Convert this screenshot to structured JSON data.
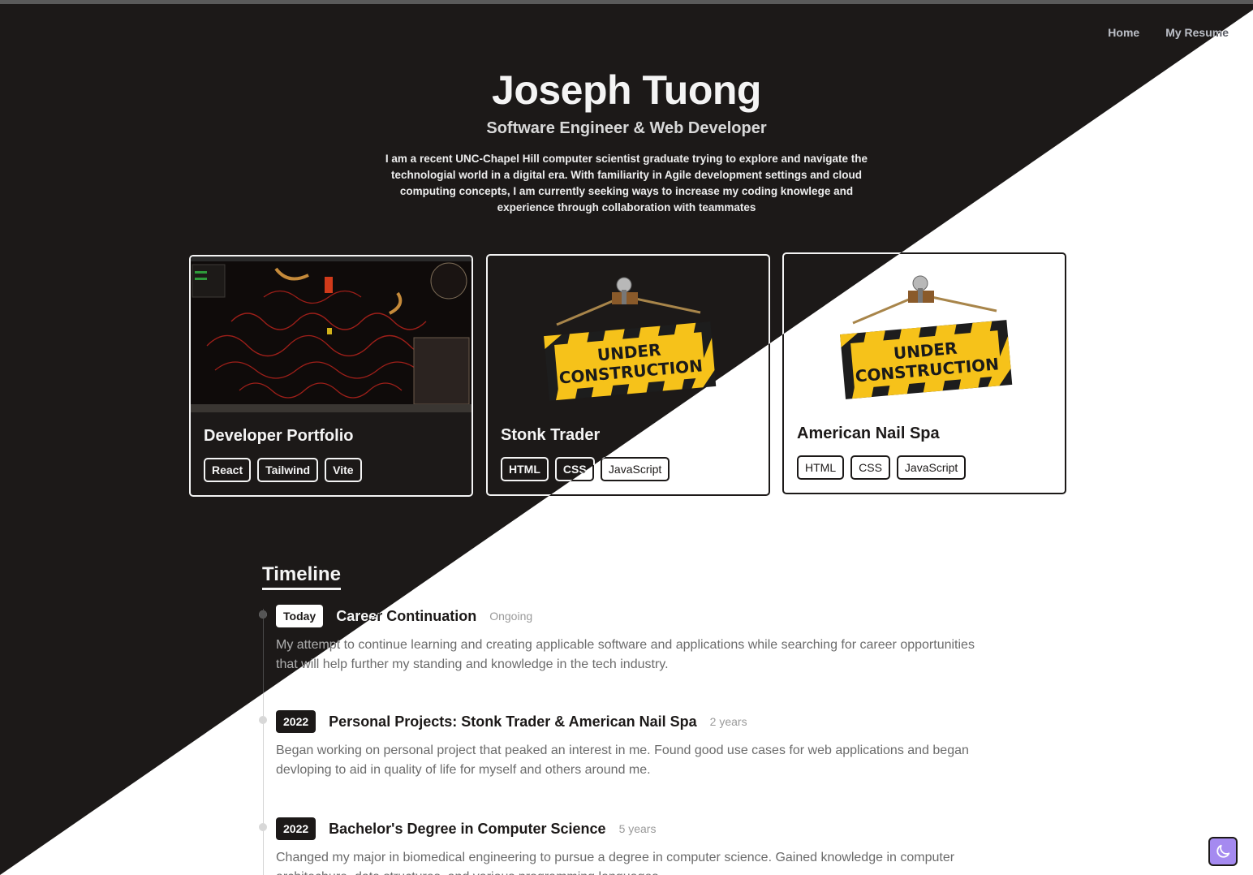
{
  "colors": {
    "dark_bg": "#1c1918",
    "light_bg": "#ffffff",
    "toggle_bg": "#a58af0"
  },
  "nav": {
    "home": "Home",
    "resume": "My Resume"
  },
  "hero": {
    "name": "Joseph Tuong",
    "title": "Software Engineer & Web Developer",
    "bio": "I am a recent UNC-Chapel Hill computer scientist graduate trying to explore and navigate the technologial world in a digital era. With familiarity in Agile development settings and cloud computing concepts, I am currently seeking ways to increase my coding knowlege and experience through collaboration with teammates"
  },
  "projects": [
    {
      "title": "Developer Portfolio",
      "image": "game-screenshot",
      "tags": [
        "React",
        "Tailwind",
        "Vite"
      ]
    },
    {
      "title": "Stonk Trader",
      "image": "under-construction-sign",
      "sign_lines": [
        "UNDER",
        "CONSTRUCTION"
      ],
      "tags": [
        "HTML",
        "CSS",
        "JavaScript"
      ]
    },
    {
      "title": "American Nail Spa",
      "image": "under-construction-sign",
      "sign_lines": [
        "UNDER",
        "CONSTRUCTION"
      ],
      "tags": [
        "HTML",
        "CSS",
        "JavaScript"
      ]
    }
  ],
  "timeline": {
    "heading": "Timeline",
    "entries": [
      {
        "badge": "Today",
        "title": "Career Continuation",
        "duration": "Ongoing",
        "description": "My attempt to continue learning and creating applicable software and applications while searching for career opportunities that will help further my standing and knowledge in the tech industry."
      },
      {
        "badge": "2022",
        "title": "Personal Projects: Stonk Trader & American Nail Spa",
        "duration": "2 years",
        "description": "Began working on personal project that peaked an interest in me. Found good use cases for web applications and began devloping to aid in quality of life for myself and others around me."
      },
      {
        "badge": "2022",
        "title": "Bachelor's Degree in Computer Science",
        "duration": "5 years",
        "description": "Changed my major in biomedical engineering to pursue a degree in computer science. Gained knowledge in computer architechure, data structures, and various programming languages."
      }
    ]
  },
  "theme_toggle": {
    "icon": "moon-icon"
  }
}
